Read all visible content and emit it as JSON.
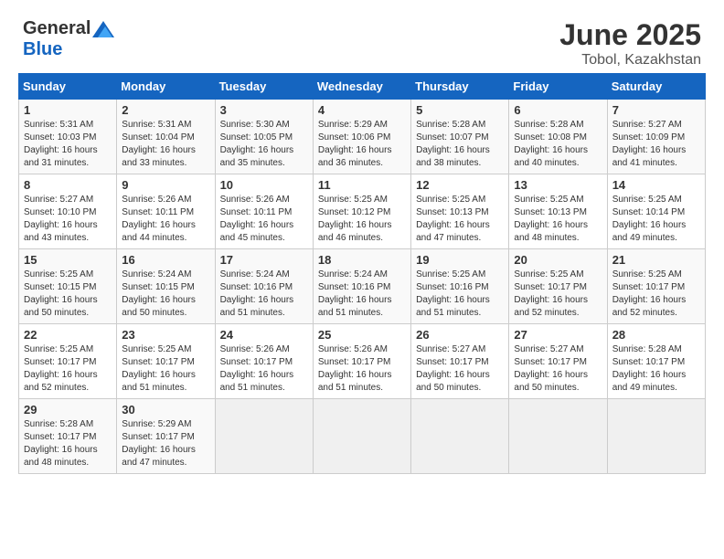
{
  "header": {
    "logo_general": "General",
    "logo_blue": "Blue",
    "month_title": "June 2025",
    "location": "Tobol, Kazakhstan"
  },
  "calendar": {
    "days_of_week": [
      "Sunday",
      "Monday",
      "Tuesday",
      "Wednesday",
      "Thursday",
      "Friday",
      "Saturday"
    ],
    "weeks": [
      [
        null,
        {
          "day": 2,
          "sunrise": "5:31 AM",
          "sunset": "10:04 PM",
          "daylight": "16 hours and 33 minutes."
        },
        {
          "day": 3,
          "sunrise": "5:30 AM",
          "sunset": "10:05 PM",
          "daylight": "16 hours and 35 minutes."
        },
        {
          "day": 4,
          "sunrise": "5:29 AM",
          "sunset": "10:06 PM",
          "daylight": "16 hours and 36 minutes."
        },
        {
          "day": 5,
          "sunrise": "5:28 AM",
          "sunset": "10:07 PM",
          "daylight": "16 hours and 38 minutes."
        },
        {
          "day": 6,
          "sunrise": "5:28 AM",
          "sunset": "10:08 PM",
          "daylight": "16 hours and 40 minutes."
        },
        {
          "day": 7,
          "sunrise": "5:27 AM",
          "sunset": "10:09 PM",
          "daylight": "16 hours and 41 minutes."
        }
      ],
      [
        {
          "day": 1,
          "sunrise": "5:31 AM",
          "sunset": "10:03 PM",
          "daylight": "16 hours and 31 minutes."
        },
        {
          "day": 8,
          "sunrise": "5:27 AM",
          "sunset": "10:10 PM",
          "daylight": "16 hours and 43 minutes."
        },
        {
          "day": 9,
          "sunrise": "5:26 AM",
          "sunset": "10:11 PM",
          "daylight": "16 hours and 44 minutes."
        },
        {
          "day": 10,
          "sunrise": "5:26 AM",
          "sunset": "10:11 PM",
          "daylight": "16 hours and 45 minutes."
        },
        {
          "day": 11,
          "sunrise": "5:25 AM",
          "sunset": "10:12 PM",
          "daylight": "16 hours and 46 minutes."
        },
        {
          "day": 12,
          "sunrise": "5:25 AM",
          "sunset": "10:13 PM",
          "daylight": "16 hours and 47 minutes."
        },
        {
          "day": 13,
          "sunrise": "5:25 AM",
          "sunset": "10:13 PM",
          "daylight": "16 hours and 48 minutes."
        },
        {
          "day": 14,
          "sunrise": "5:25 AM",
          "sunset": "10:14 PM",
          "daylight": "16 hours and 49 minutes."
        }
      ],
      [
        {
          "day": 15,
          "sunrise": "5:25 AM",
          "sunset": "10:15 PM",
          "daylight": "16 hours and 50 minutes."
        },
        {
          "day": 16,
          "sunrise": "5:24 AM",
          "sunset": "10:15 PM",
          "daylight": "16 hours and 50 minutes."
        },
        {
          "day": 17,
          "sunrise": "5:24 AM",
          "sunset": "10:16 PM",
          "daylight": "16 hours and 51 minutes."
        },
        {
          "day": 18,
          "sunrise": "5:24 AM",
          "sunset": "10:16 PM",
          "daylight": "16 hours and 51 minutes."
        },
        {
          "day": 19,
          "sunrise": "5:25 AM",
          "sunset": "10:16 PM",
          "daylight": "16 hours and 51 minutes."
        },
        {
          "day": 20,
          "sunrise": "5:25 AM",
          "sunset": "10:17 PM",
          "daylight": "16 hours and 52 minutes."
        },
        {
          "day": 21,
          "sunrise": "5:25 AM",
          "sunset": "10:17 PM",
          "daylight": "16 hours and 52 minutes."
        }
      ],
      [
        {
          "day": 22,
          "sunrise": "5:25 AM",
          "sunset": "10:17 PM",
          "daylight": "16 hours and 52 minutes."
        },
        {
          "day": 23,
          "sunrise": "5:25 AM",
          "sunset": "10:17 PM",
          "daylight": "16 hours and 51 minutes."
        },
        {
          "day": 24,
          "sunrise": "5:26 AM",
          "sunset": "10:17 PM",
          "daylight": "16 hours and 51 minutes."
        },
        {
          "day": 25,
          "sunrise": "5:26 AM",
          "sunset": "10:17 PM",
          "daylight": "16 hours and 51 minutes."
        },
        {
          "day": 26,
          "sunrise": "5:27 AM",
          "sunset": "10:17 PM",
          "daylight": "16 hours and 50 minutes."
        },
        {
          "day": 27,
          "sunrise": "5:27 AM",
          "sunset": "10:17 PM",
          "daylight": "16 hours and 50 minutes."
        },
        {
          "day": 28,
          "sunrise": "5:28 AM",
          "sunset": "10:17 PM",
          "daylight": "16 hours and 49 minutes."
        }
      ],
      [
        {
          "day": 29,
          "sunrise": "5:28 AM",
          "sunset": "10:17 PM",
          "daylight": "16 hours and 48 minutes."
        },
        {
          "day": 30,
          "sunrise": "5:29 AM",
          "sunset": "10:17 PM",
          "daylight": "16 hours and 47 minutes."
        },
        null,
        null,
        null,
        null,
        null
      ]
    ]
  }
}
